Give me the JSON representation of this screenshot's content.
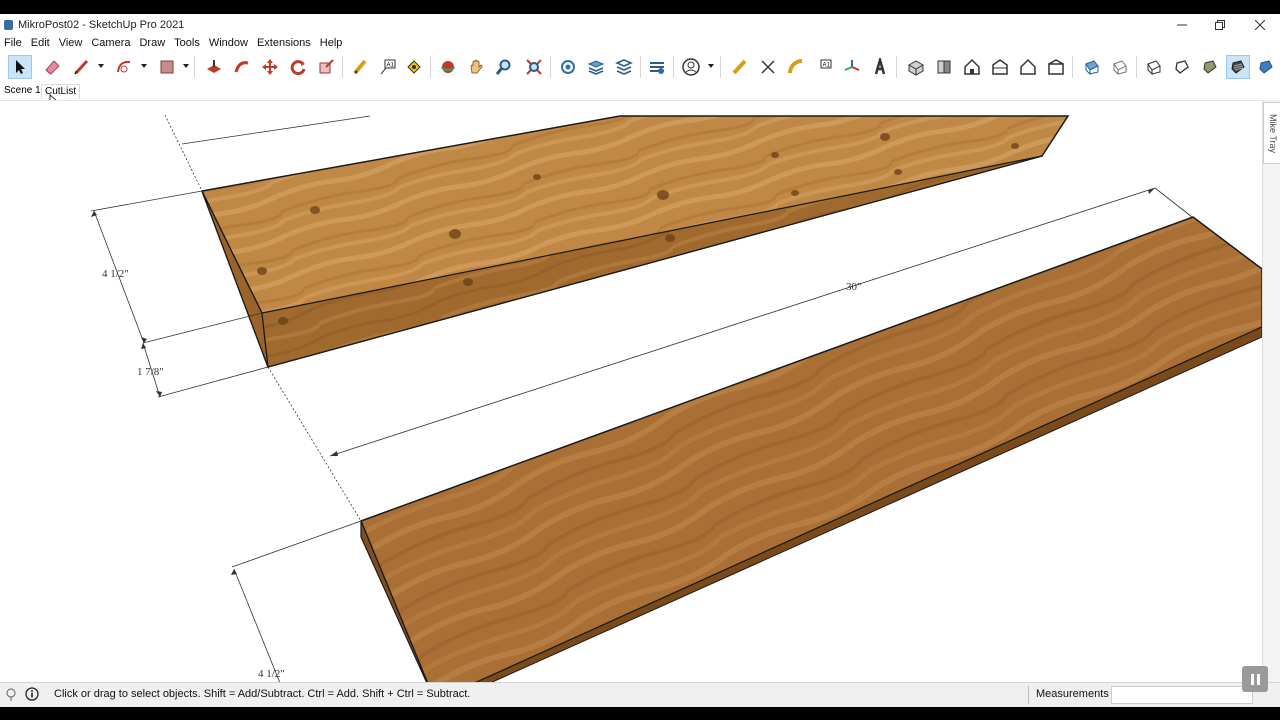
{
  "window": {
    "title": "MikroPost02 - SketchUp Pro 2021"
  },
  "menu": [
    "File",
    "Edit",
    "View",
    "Camera",
    "Draw",
    "Tools",
    "Window",
    "Extensions",
    "Help"
  ],
  "scenes": [
    "Scene 1",
    "CutList"
  ],
  "active_scene": "CutList",
  "active_tool": "select",
  "toolbar_icons": [
    "select-tool-icon",
    "eraser-tool-icon",
    "line-tool-icon",
    "arc-tool-icon",
    "rectangle-tool-icon",
    "push-pull-tool-icon",
    "follow-me-tool-icon",
    "move-tool-icon",
    "rotate-tool-icon",
    "scale-tool-icon",
    "tape-measure-icon",
    "text-tool-icon",
    "paint-bucket-icon",
    "orbit-icon",
    "pan-icon",
    "zoom-icon",
    "zoom-extents-icon",
    "outliner-icon",
    "layers-icon",
    "tags-icon",
    "styles-icon",
    "entity-info-icon",
    "measure-icon",
    "dimension-icon",
    "protractor-icon",
    "text-label-icon",
    "axes-icon",
    "3d-text-icon",
    "iso-view-icon",
    "top-view-icon",
    "front-view-icon",
    "right-view-icon",
    "back-view-icon",
    "left-view-icon",
    "xray-icon",
    "back-edges-icon",
    "wireframe-icon",
    "hidden-line-icon",
    "shaded-icon",
    "shaded-textures-icon",
    "monochrome-icon"
  ],
  "dimensions": {
    "width_top": "4 1/2\"",
    "thickness": "1 7/8\"",
    "length": "30\"",
    "width_bottom": "4 1/2\""
  },
  "tray": {
    "label": "Mike Tray"
  },
  "status": {
    "hint": "Click or drag to select objects. Shift = Add/Subtract. Ctrl = Add. Shift + Ctrl = Subtract.",
    "measurements_label": "Measurements",
    "measurements_value": ""
  },
  "colors": {
    "wood_top": "#b57f3f",
    "wood_side": "#8f5a24",
    "wood_plank": "#a26b33",
    "active_tool_bg": "#cce4f7"
  }
}
